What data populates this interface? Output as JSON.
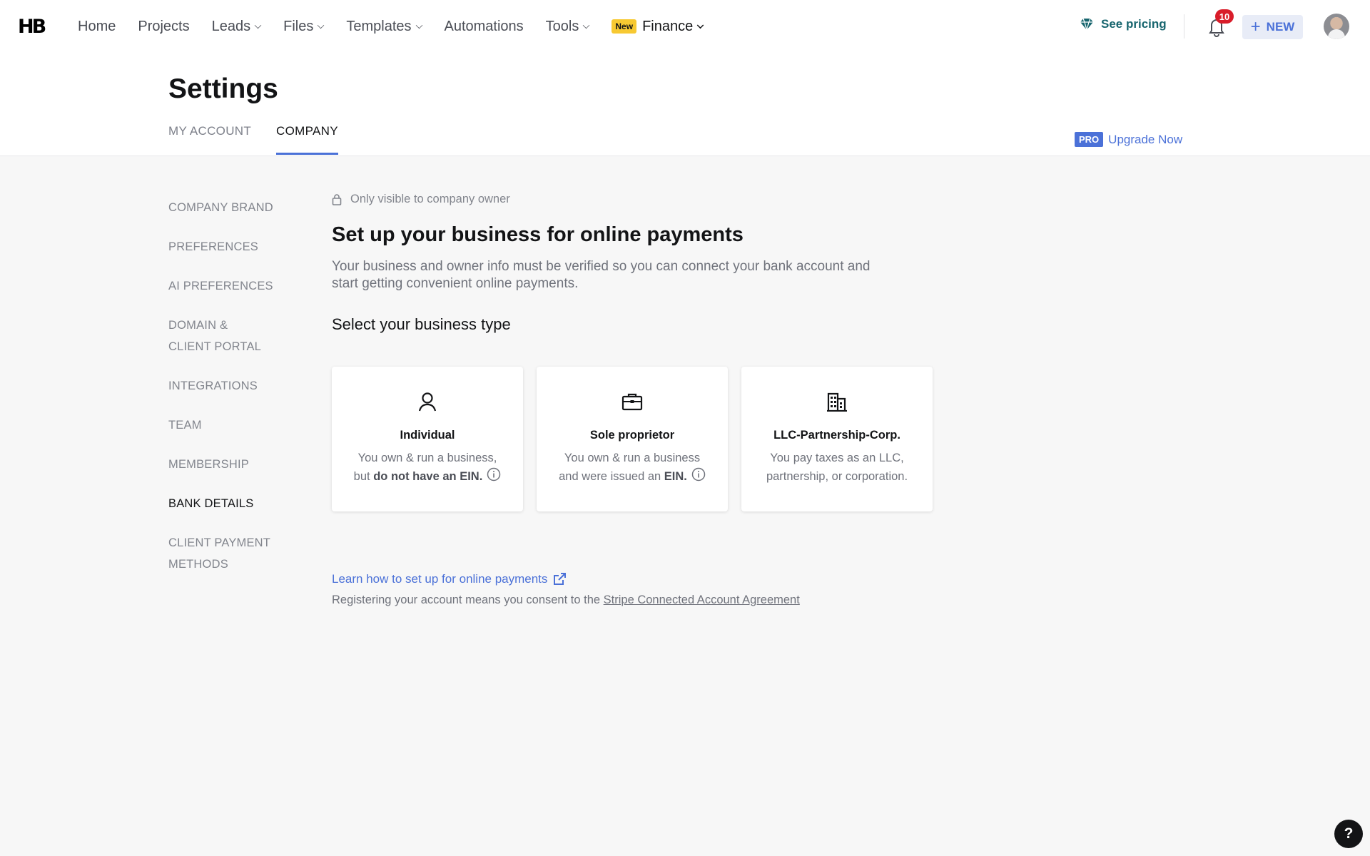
{
  "brand": {
    "logo_text": "HB"
  },
  "nav": {
    "items": [
      {
        "label": "Home"
      },
      {
        "label": "Projects"
      },
      {
        "label": "Leads"
      },
      {
        "label": "Files"
      },
      {
        "label": "Templates"
      },
      {
        "label": "Automations"
      },
      {
        "label": "Tools"
      }
    ],
    "finance": {
      "badge": "New",
      "label": "Finance"
    }
  },
  "topbar": {
    "see_pricing": "See pricing",
    "notifications_count": "10",
    "new_button": "NEW"
  },
  "header": {
    "title": "Settings",
    "tabs": [
      {
        "label": "MY ACCOUNT"
      },
      {
        "label": "COMPANY",
        "active": true
      }
    ],
    "upgrade": {
      "tag": "PRO",
      "label": "Upgrade Now"
    }
  },
  "sidebar": {
    "items": [
      {
        "label": "COMPANY BRAND"
      },
      {
        "label": "PREFERENCES"
      },
      {
        "label": "AI PREFERENCES"
      },
      {
        "label": "DOMAIN &",
        "label2": "CLIENT PORTAL"
      },
      {
        "label": "INTEGRATIONS"
      },
      {
        "label": "TEAM"
      },
      {
        "label": "MEMBERSHIP"
      },
      {
        "label": "BANK DETAILS",
        "active": true
      },
      {
        "label": "CLIENT PAYMENT",
        "label2": "METHODS"
      }
    ]
  },
  "main": {
    "visibility_note": "Only visible to company owner",
    "heading": "Set up your business for online payments",
    "description": "Your business and owner info must be verified so you can connect your bank account and start getting convenient online payments.",
    "select_heading": "Select your business type",
    "cards": [
      {
        "icon": "person-icon",
        "title": "Individual",
        "line1": "You own & run a business,",
        "line2_pre": "but ",
        "line2_bold": "do not have an EIN.",
        "has_info": true
      },
      {
        "icon": "briefcase-icon",
        "title": "Sole proprietor",
        "line1": "You own & run a business",
        "line2_pre": "and were issued an ",
        "line2_bold": "EIN.",
        "has_info": true
      },
      {
        "icon": "building-icon",
        "title": "LLC-Partnership-Corp.",
        "line1": "You pay taxes as an LLC,",
        "line2_pre": "partnership, or corporation.",
        "line2_bold": "",
        "has_info": false
      }
    ],
    "learn_link": "Learn how to set up for online payments",
    "consent_text": "Registering your account means you consent to the ",
    "consent_link": "Stripe Connected Account Agreement"
  },
  "help": {
    "label": "?"
  },
  "colors": {
    "accent": "#4b71d8",
    "teal": "#17656e",
    "badge_yellow": "#f7c932",
    "notif_red": "#d91d2a"
  }
}
